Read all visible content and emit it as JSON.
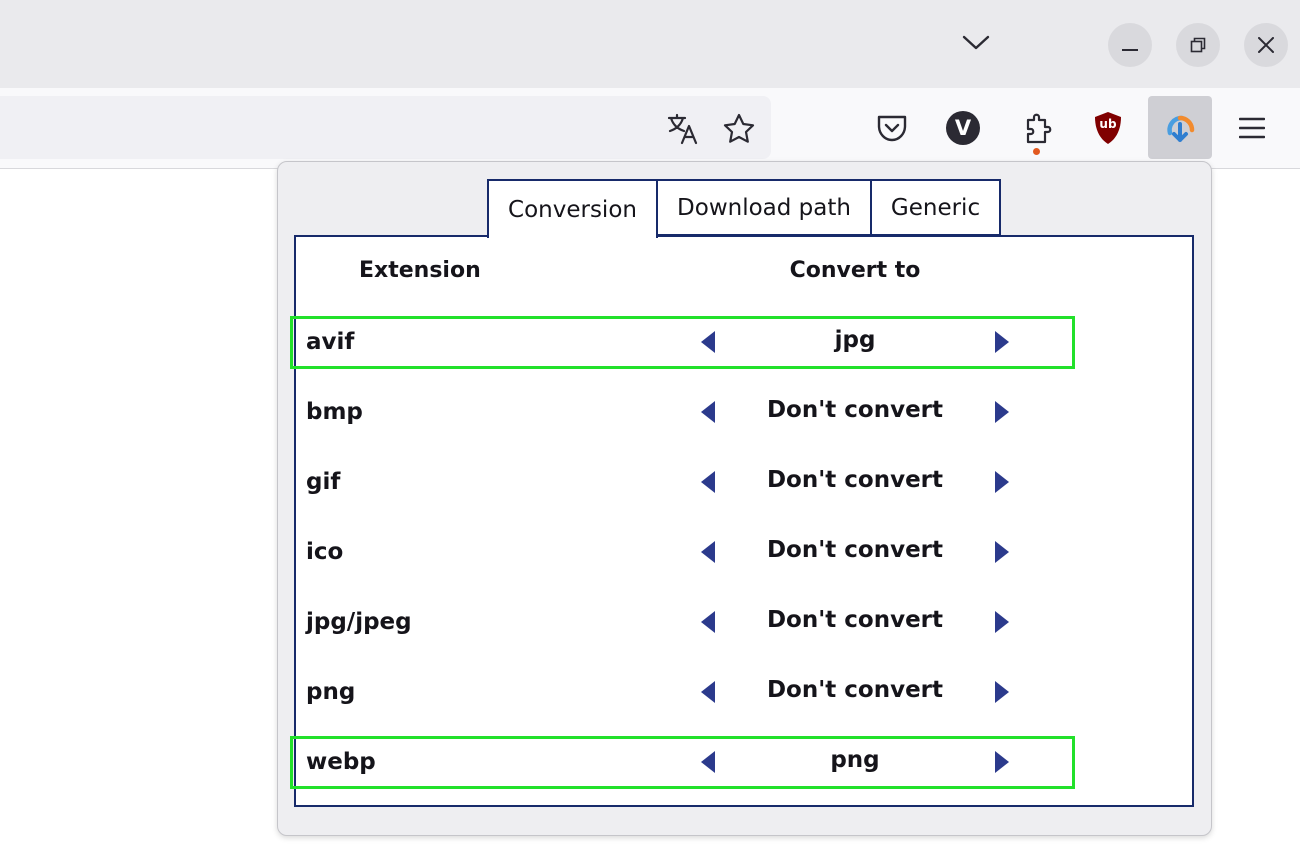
{
  "colors": {
    "accent": "#172a6a",
    "arrow": "#2b3a8c",
    "highlight": "#22e12a",
    "ublock": "#800000",
    "notification_dot": "#e25920"
  },
  "toolbar": {
    "icons": [
      "chevron-down-icon",
      "minimize-icon",
      "restore-icon",
      "close-icon",
      "translate-icon",
      "bookmark-star-icon",
      "pocket-icon",
      "extension-v-icon",
      "extensions-puzzle-icon",
      "ublock-icon",
      "image-converter-extension-icon",
      "hamburger-menu-icon"
    ],
    "v_label": "V",
    "ublock_label": "ub"
  },
  "popup": {
    "tabs": [
      {
        "label": "Conversion",
        "active": true
      },
      {
        "label": "Download path",
        "active": false
      },
      {
        "label": "Generic",
        "active": false
      }
    ],
    "headers": {
      "extension": "Extension",
      "convert_to": "Convert to"
    },
    "rows": [
      {
        "extension": "avif",
        "value": "jpg",
        "highlighted": true
      },
      {
        "extension": "bmp",
        "value": "Don't convert",
        "highlighted": false
      },
      {
        "extension": "gif",
        "value": "Don't convert",
        "highlighted": false
      },
      {
        "extension": "ico",
        "value": "Don't convert",
        "highlighted": false
      },
      {
        "extension": "jpg/jpeg",
        "value": "Don't convert",
        "highlighted": false
      },
      {
        "extension": "png",
        "value": "Don't convert",
        "highlighted": false
      },
      {
        "extension": "webp",
        "value": "png",
        "highlighted": true
      }
    ]
  }
}
